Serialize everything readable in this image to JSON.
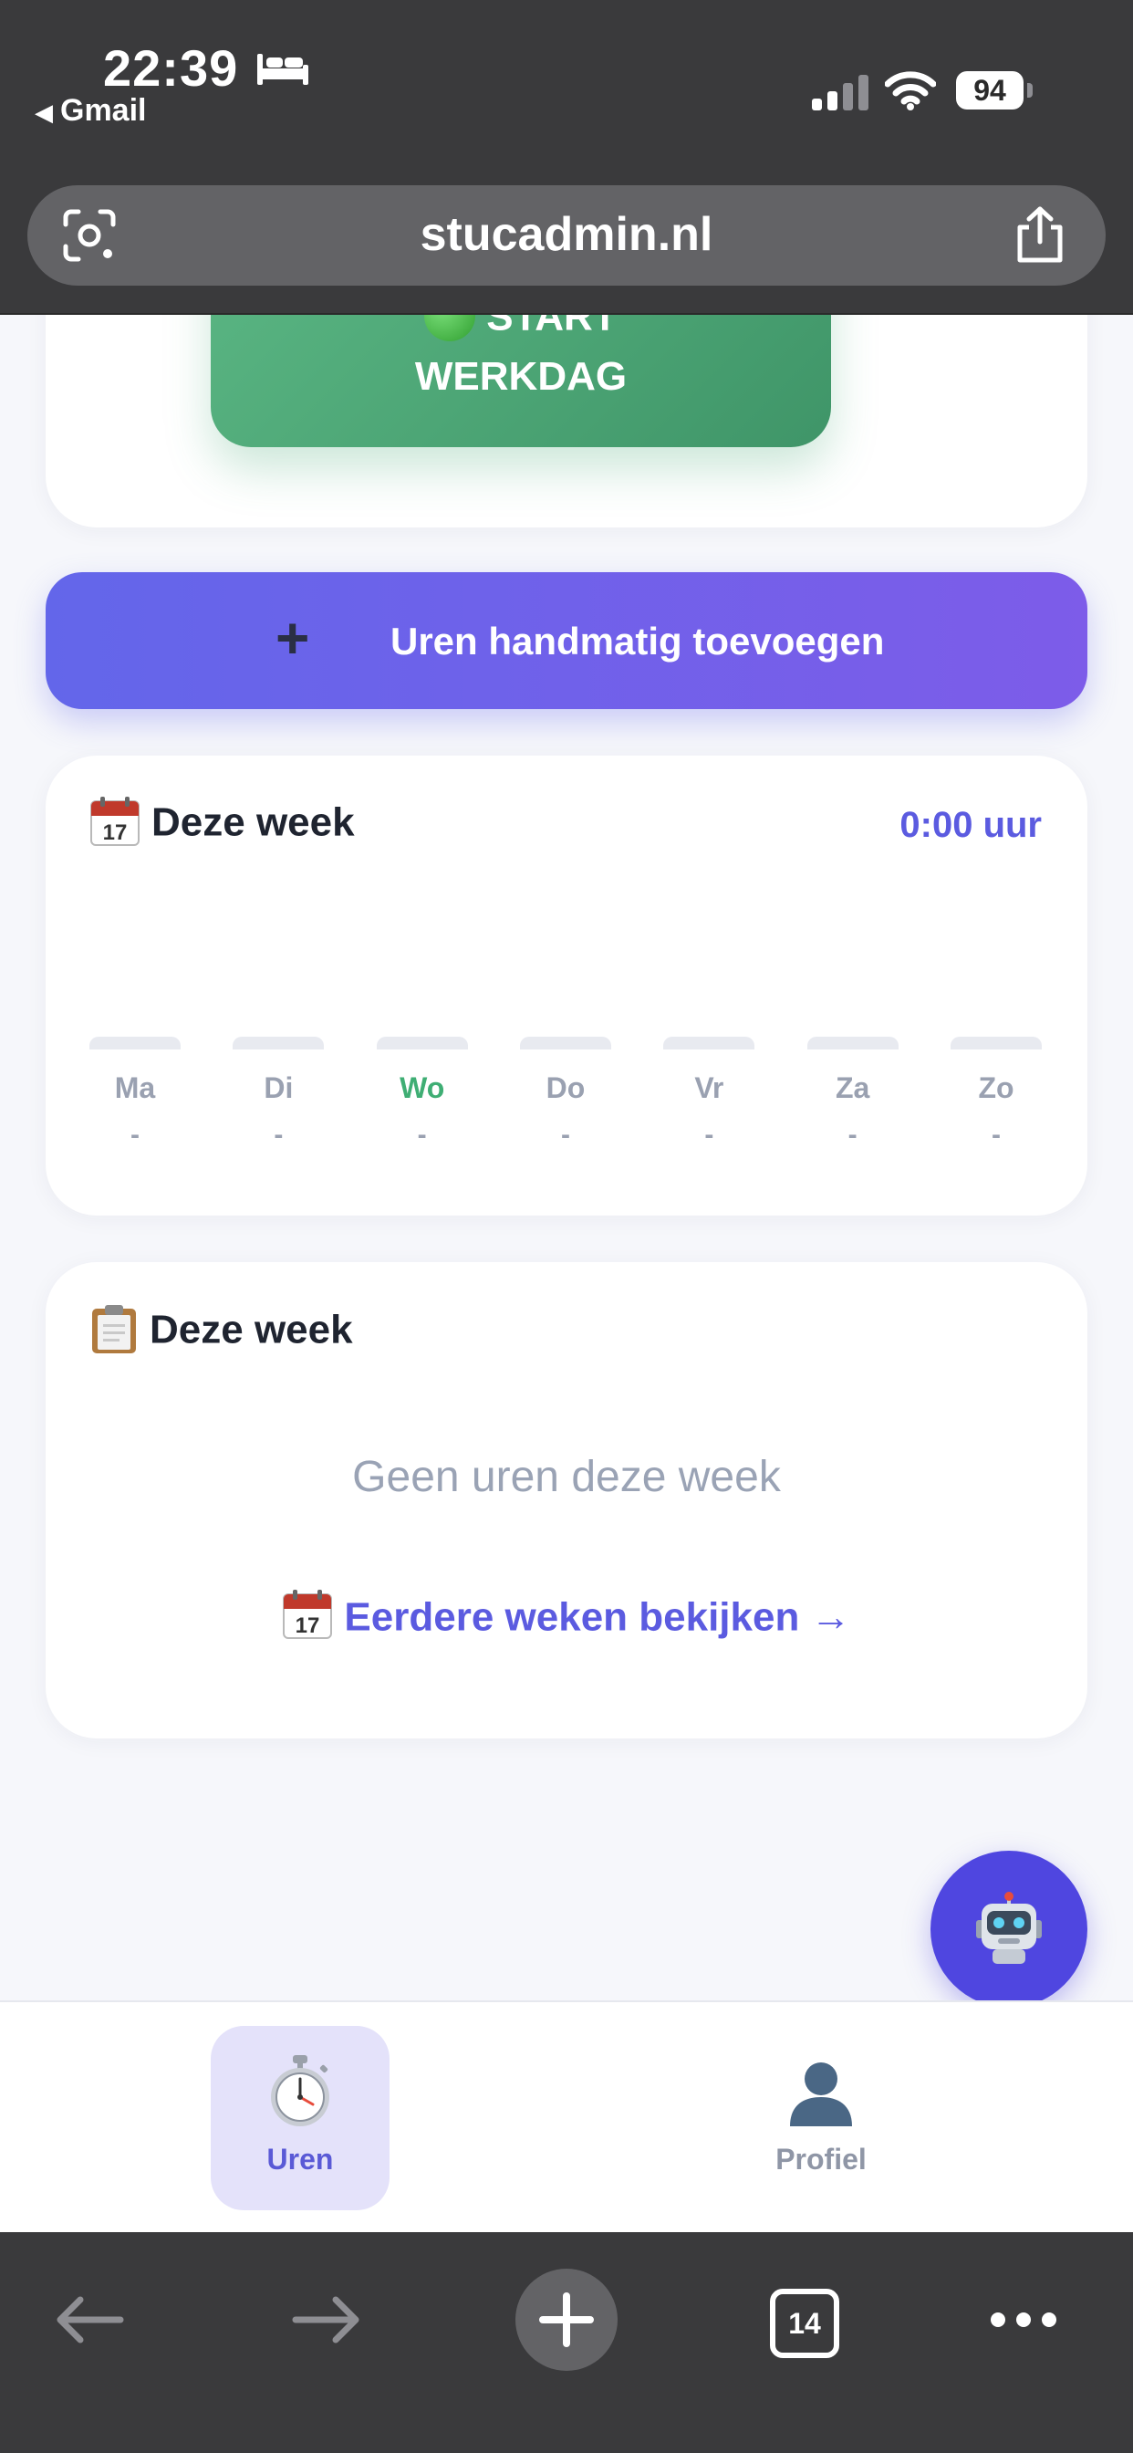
{
  "status_bar": {
    "time": "22:39",
    "back_app": "Gmail",
    "battery": "94",
    "icons": [
      "bed-icon",
      "signal-icon",
      "wifi-icon",
      "battery-icon"
    ]
  },
  "browser": {
    "url": "stucadmin.nl",
    "tabs_count": "14"
  },
  "start_button": {
    "line1": "START",
    "line2": "WERKDAG",
    "icon": "green-circle-icon"
  },
  "manual_button": {
    "label": "Uren handmatig toevoegen",
    "icon": "plus-icon"
  },
  "week_card": {
    "title": "Deze week",
    "icon": "calendar-icon",
    "total": "0:00 uur",
    "days": [
      {
        "name": "Ma",
        "value": "-",
        "hours": 0
      },
      {
        "name": "Di",
        "value": "-",
        "hours": 0
      },
      {
        "name": "Wo",
        "value": "-",
        "hours": 0,
        "today": true
      },
      {
        "name": "Do",
        "value": "-",
        "hours": 0
      },
      {
        "name": "Vr",
        "value": "-",
        "hours": 0
      },
      {
        "name": "Za",
        "value": "-",
        "hours": 0
      },
      {
        "name": "Zo",
        "value": "-",
        "hours": 0
      }
    ]
  },
  "list_card": {
    "title": "Deze week",
    "icon": "clipboard-icon",
    "empty_text": "Geen uren deze week",
    "earlier_link": "Eerdere weken bekijken →"
  },
  "fab": {
    "icon": "robot-icon"
  },
  "bottom_nav": {
    "items": [
      {
        "label": "Uren",
        "icon": "stopwatch-icon",
        "active": true
      },
      {
        "label": "Profiel",
        "icon": "person-icon",
        "active": false
      }
    ]
  },
  "colors": {
    "primary": "#6366ea",
    "accent_green": "#4caf7d",
    "link": "#5b5be0",
    "fab": "#4f46e0"
  }
}
